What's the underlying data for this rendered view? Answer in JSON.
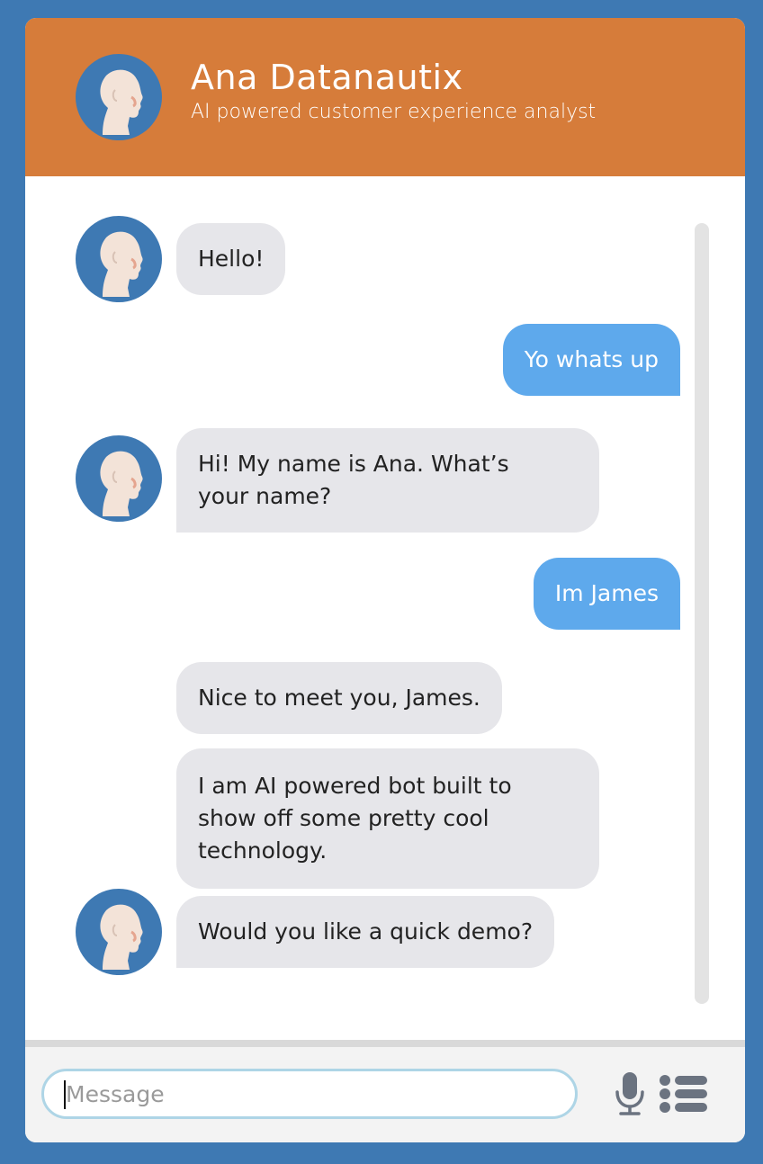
{
  "header": {
    "title": "Ana Datanautix",
    "subtitle": "AI powered customer experience analyst",
    "avatar_icon": "bot-avatar-icon"
  },
  "messages": [
    {
      "sender": "bot",
      "text": "Hello!"
    },
    {
      "sender": "user",
      "text": "Yo whats up"
    },
    {
      "sender": "bot",
      "text": "Hi! My name is Ana. What’s\nyour name?"
    },
    {
      "sender": "user",
      "text": "Im James"
    },
    {
      "sender": "bot",
      "text": "Nice to meet you, James."
    },
    {
      "sender": "bot",
      "text": "I am AI powered bot built to\nshow off some pretty cool\ntechnology."
    },
    {
      "sender": "bot",
      "text": "Would you like a quick demo?"
    }
  ],
  "composer": {
    "placeholder": "Message",
    "value": "",
    "mic_icon": "microphone-icon",
    "menu_icon": "list-menu-icon"
  },
  "colors": {
    "background": "#3e79b3",
    "header": "#d67c3a",
    "bot_bubble": "#e6e6ea",
    "user_bubble": "#5ea9ec",
    "input_border": "#aed5e6"
  }
}
